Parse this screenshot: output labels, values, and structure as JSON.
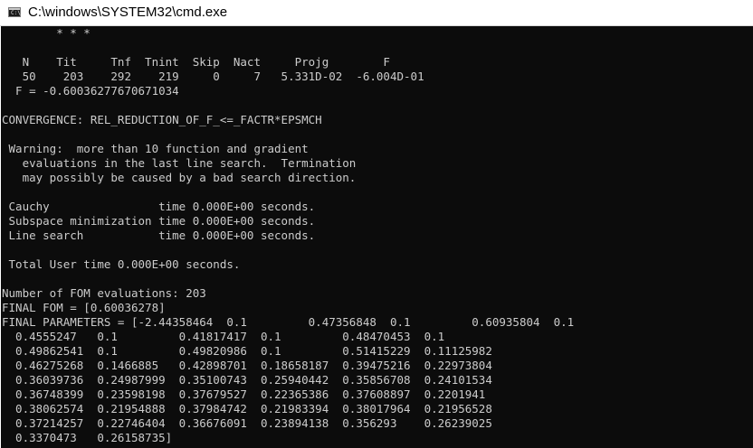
{
  "window": {
    "title": "C:\\windows\\SYSTEM32\\cmd.exe",
    "icon": "cmd-console-icon",
    "icon_glyph": "C:\\"
  },
  "console": {
    "lines": [
      "        * * *",
      "",
      "   N    Tit     Tnf  Tnint  Skip  Nact     Projg        F",
      "   50    203    292    219     0     7   5.331D-02  -6.004D-01",
      "  F = -0.60036277670671034",
      "",
      "CONVERGENCE: REL_REDUCTION_OF_F_<=_FACTR*EPSMCH",
      "",
      " Warning:  more than 10 function and gradient",
      "   evaluations in the last line search.  Termination",
      "   may possibly be caused by a bad search direction.",
      "",
      " Cauchy                time 0.000E+00 seconds.",
      " Subspace minimization time 0.000E+00 seconds.",
      " Line search           time 0.000E+00 seconds.",
      "",
      " Total User time 0.000E+00 seconds.",
      "",
      "Number of FOM evaluations: 203",
      "FINAL FOM = [0.60036278]",
      "FINAL PARAMETERS = [-2.44358464  0.1         0.47356848  0.1         0.60935804  0.1",
      "  0.4555247   0.1         0.41817417  0.1         0.48470453  0.1",
      "  0.49862541  0.1         0.49820986  0.1         0.51415229  0.11125982",
      "  0.46275268  0.1466885   0.42898701  0.18658187  0.39475216  0.22973804",
      "  0.36039736  0.24987999  0.35100743  0.25940442  0.35856708  0.24101534",
      "  0.36748399  0.23598198  0.37679527  0.22365386  0.37608897  0.2201941",
      "  0.38062574  0.21954888  0.37984742  0.21983394  0.38017964  0.21956528",
      "  0.37214257  0.22746404  0.36676091  0.23894138  0.356293    0.26239025",
      "  0.3370473   0.26158735]"
    ]
  }
}
